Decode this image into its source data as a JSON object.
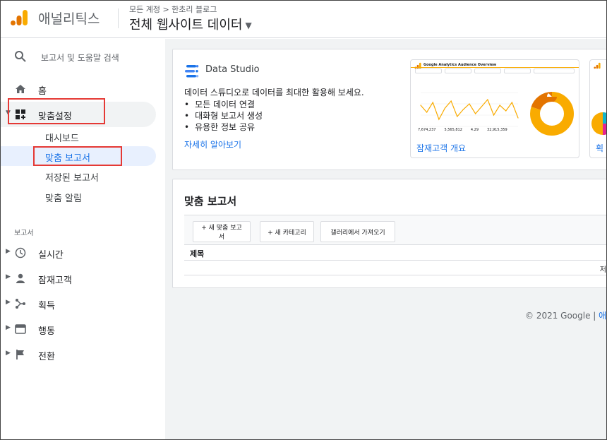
{
  "header": {
    "app_name": "애널리틱스",
    "breadcrumb": "모든 계정 > 한초리 블로그",
    "view_title": "전체 웹사이트 데이터"
  },
  "sidebar": {
    "search_label": "보고서 및 도움말 검색",
    "home": "홈",
    "customization": "맞춤설정",
    "sub_items": [
      "대시보드",
      "맞춤 보고서",
      "저장된 보고서",
      "맞춤 알림"
    ],
    "section_reports": "보고서",
    "report_items": [
      "실시간",
      "잠재고객",
      "획득",
      "행동",
      "전환"
    ]
  },
  "data_studio": {
    "name": "Data Studio",
    "headline": "데이터 스튜디오로 데이터를 최대한 활용해 보세요.",
    "bullets": [
      "모든 데이터 연결",
      "대화형 보고서 생성",
      "유용한 정보 공유"
    ],
    "learn_more": "자세히 알아보기",
    "thumb1_caption": "잠재고객 개요",
    "thumb1_title": "Google Analytics Audience Overview",
    "thumb2_caption": "획"
  },
  "custom_reports": {
    "title": "맞춤 보고서",
    "new_report_button": "+ 새 맞춤 보고서",
    "new_category_button": "+ 새 카테고리",
    "gallery_button": "갤러리에서 가져오기",
    "col_title": "제목",
    "row_partial": "저"
  },
  "footer": {
    "copyright": "© 2021 Google |",
    "link": "애널"
  },
  "colors": {
    "accent": "#1a73e8",
    "highlight": "#e53935",
    "analytics_orange": "#f9ab00",
    "analytics_dark_orange": "#e37400"
  },
  "chart_data": {
    "type": "line",
    "title": "Google Analytics Audience Overview",
    "series": [
      {
        "values": [
          60,
          55,
          62,
          50,
          58,
          63,
          52,
          57,
          61,
          54,
          59,
          64,
          53,
          60,
          56,
          62,
          51
        ]
      }
    ],
    "stats": [
      {
        "value": "7,674,237"
      },
      {
        "value": "5,565,812"
      },
      {
        "value": "4.29"
      },
      {
        "value": "32,915,359"
      }
    ],
    "donut": [
      {
        "value": 80,
        "color": "#f9ab00"
      },
      {
        "value": 20,
        "color": "#e37400"
      }
    ]
  }
}
